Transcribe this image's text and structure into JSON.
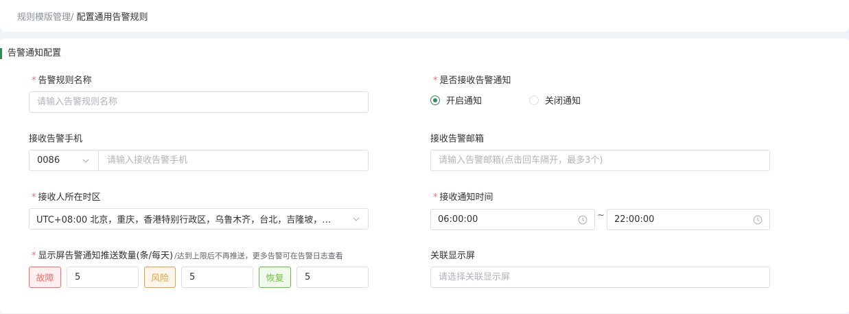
{
  "breadcrumb": {
    "parent": "规则模版管理/",
    "current": " 配置通用告警规则"
  },
  "section": {
    "title": "告警通知配置"
  },
  "rule_name": {
    "label": "告警规则名称",
    "placeholder": "请输入告警规则名称"
  },
  "notify_enable": {
    "label": "是否接收告警通知",
    "options": [
      "开启通知",
      "关闭通知"
    ],
    "selected": "开启通知"
  },
  "phone": {
    "label": "接收告警手机",
    "country_code": "0086",
    "placeholder": "请输入接收告警手机"
  },
  "email": {
    "label": "接收告警邮箱",
    "placeholder": "请输入告警邮箱(点击回车隔开，最多3个)"
  },
  "timezone": {
    "label": "接收人所在时区",
    "value": "UTC+08:00 北京，重庆，香港特别行政区，乌鲁木齐，台北，吉隆坡，…"
  },
  "notify_time": {
    "label": "接收通知时间",
    "start": "06:00:00",
    "separator": "~",
    "end": "22:00:00"
  },
  "push_limit": {
    "label": "显示屏告警通知推送数量(条/每天)",
    "hint": "/达到上限后不再推送，更多告警可在告警日志查看",
    "items": [
      {
        "tag": "故障",
        "value": "5"
      },
      {
        "tag": "风险",
        "value": "5"
      },
      {
        "tag": "恢复",
        "value": "5"
      }
    ]
  },
  "screen": {
    "label": "关联显示屏",
    "placeholder": "请选择关联显示屏"
  },
  "colors": {
    "primary": "#2e8b57",
    "required": "#f56c6c",
    "fault": "#f56c6c",
    "risk": "#e6a23c",
    "recover": "#67c23a"
  },
  "icons": [
    "chevron-down-icon",
    "clock-icon"
  ]
}
